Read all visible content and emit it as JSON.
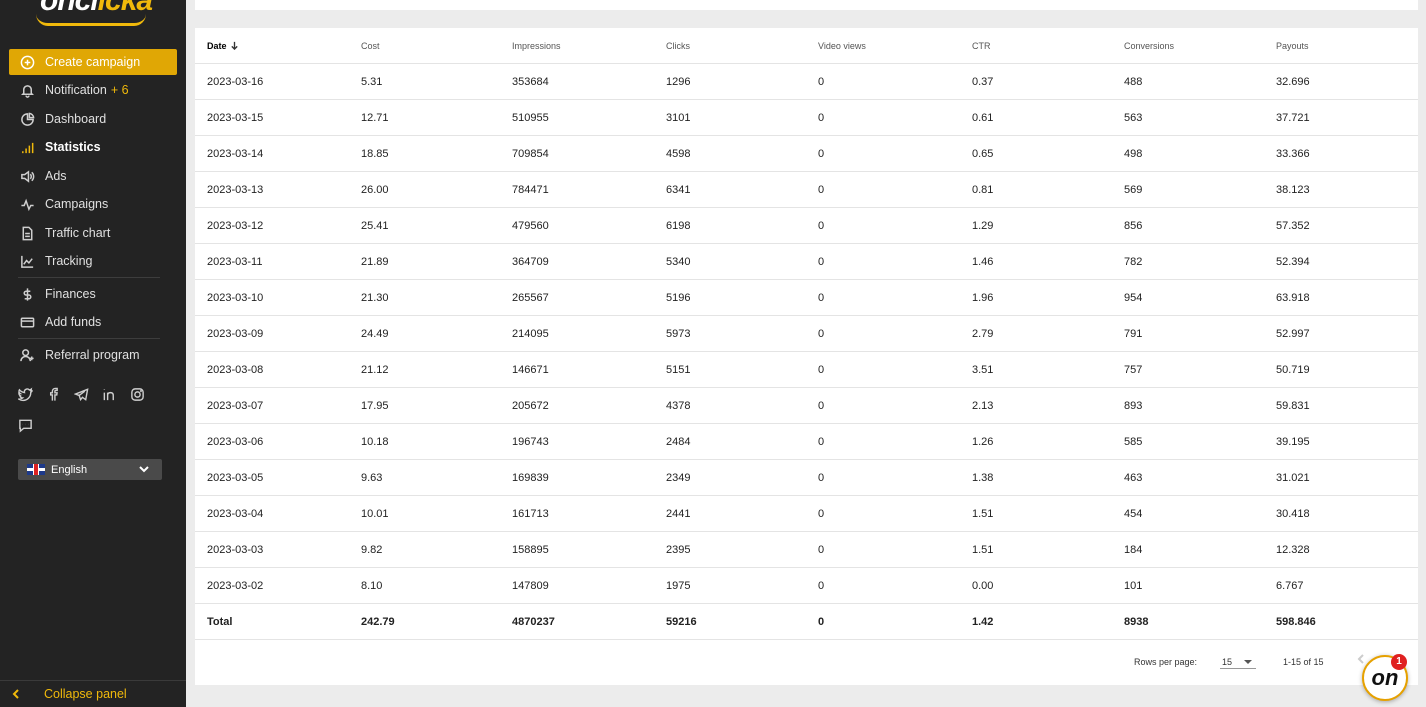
{
  "brand": {
    "logo_main": "oncl",
    "logo_accent": "icka"
  },
  "sidebar": {
    "create_campaign": "Create campaign",
    "notification": {
      "label": "Notification",
      "count": "+ 6"
    },
    "dashboard": "Dashboard",
    "statistics": "Statistics",
    "ads": "Ads",
    "campaigns": "Campaigns",
    "traffic_chart": "Traffic chart",
    "tracking": "Tracking",
    "finances": "Finances",
    "add_funds": "Add funds",
    "referral_program": "Referral program",
    "language": "English",
    "collapse": "Collapse panel"
  },
  "table": {
    "headers": [
      "Date",
      "Cost",
      "Impressions",
      "Clicks",
      "Video views",
      "CTR",
      "Conversions",
      "Payouts"
    ],
    "rows": [
      [
        "2023-03-16",
        "5.31",
        "353684",
        "1296",
        "0",
        "0.37",
        "488",
        "32.696"
      ],
      [
        "2023-03-15",
        "12.71",
        "510955",
        "3101",
        "0",
        "0.61",
        "563",
        "37.721"
      ],
      [
        "2023-03-14",
        "18.85",
        "709854",
        "4598",
        "0",
        "0.65",
        "498",
        "33.366"
      ],
      [
        "2023-03-13",
        "26.00",
        "784471",
        "6341",
        "0",
        "0.81",
        "569",
        "38.123"
      ],
      [
        "2023-03-12",
        "25.41",
        "479560",
        "6198",
        "0",
        "1.29",
        "856",
        "57.352"
      ],
      [
        "2023-03-11",
        "21.89",
        "364709",
        "5340",
        "0",
        "1.46",
        "782",
        "52.394"
      ],
      [
        "2023-03-10",
        "21.30",
        "265567",
        "5196",
        "0",
        "1.96",
        "954",
        "63.918"
      ],
      [
        "2023-03-09",
        "24.49",
        "214095",
        "5973",
        "0",
        "2.79",
        "791",
        "52.997"
      ],
      [
        "2023-03-08",
        "21.12",
        "146671",
        "5151",
        "0",
        "3.51",
        "757",
        "50.719"
      ],
      [
        "2023-03-07",
        "17.95",
        "205672",
        "4378",
        "0",
        "2.13",
        "893",
        "59.831"
      ],
      [
        "2023-03-06",
        "10.18",
        "196743",
        "2484",
        "0",
        "1.26",
        "585",
        "39.195"
      ],
      [
        "2023-03-05",
        "9.63",
        "169839",
        "2349",
        "0",
        "1.38",
        "463",
        "31.021"
      ],
      [
        "2023-03-04",
        "10.01",
        "161713",
        "2441",
        "0",
        "1.51",
        "454",
        "30.418"
      ],
      [
        "2023-03-03",
        "9.82",
        "158895",
        "2395",
        "0",
        "1.51",
        "184",
        "12.328"
      ],
      [
        "2023-03-02",
        "8.10",
        "147809",
        "1975",
        "0",
        "0.00",
        "101",
        "6.767"
      ]
    ],
    "total": [
      "Total",
      "242.79",
      "4870237",
      "59216",
      "0",
      "1.42",
      "8938",
      "598.846"
    ]
  },
  "pagination": {
    "rows_per_page_label": "Rows per page:",
    "rows_per_page_value": "15",
    "range": "1-15 of 15"
  },
  "chat_widget": {
    "label": "on",
    "badge": "1"
  },
  "colors": {
    "accent": "#e0a705",
    "sidebar_bg": "#232323",
    "page_bg": "#ececec"
  }
}
